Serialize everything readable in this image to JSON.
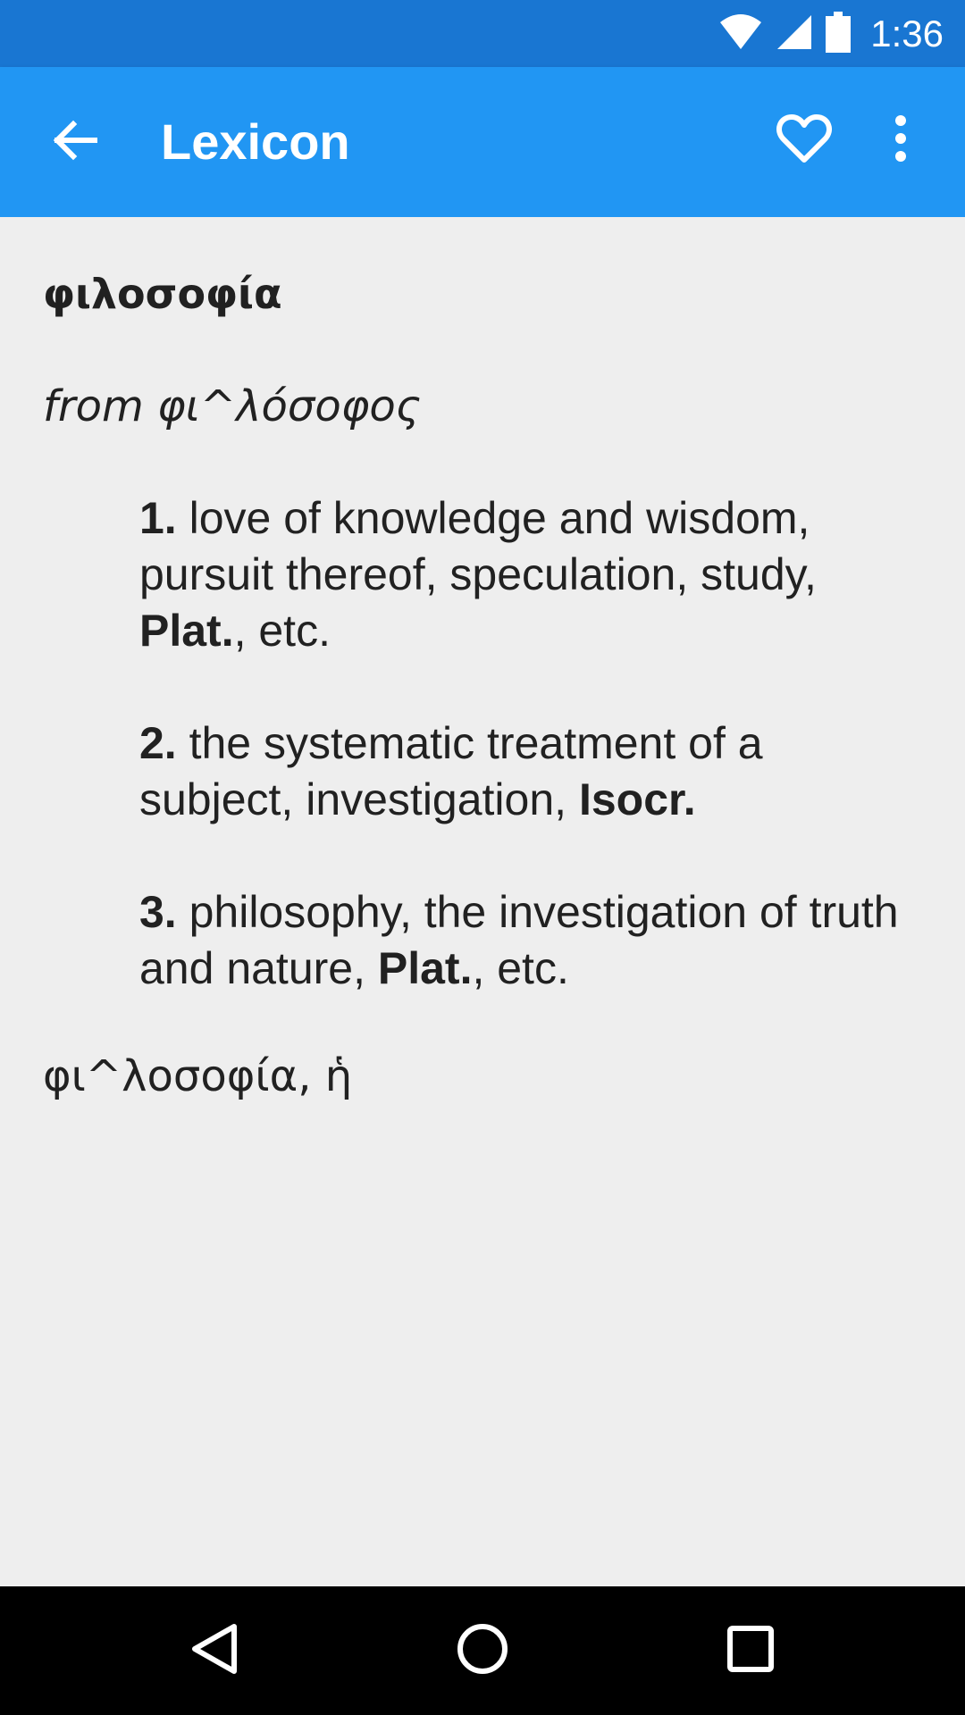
{
  "status_bar": {
    "time": "1:36",
    "icons": [
      "wifi-icon",
      "signal-icon",
      "battery-icon"
    ],
    "background": "#1976d2"
  },
  "app_bar": {
    "title": "Lexicon",
    "back_icon": "arrow-back-icon",
    "favorite_icon": "heart-outline-icon",
    "more_icon": "more-vert-icon",
    "background": "#2196f3"
  },
  "entry": {
    "headword": "φιλοσοφία",
    "etymology": "from φι^λόσοφος",
    "senses": [
      {
        "number": "1.",
        "text": " love of knowledge and wisdom, pursuit thereof, speculation, study, ",
        "ref": "Plat.",
        "tail": ", etc."
      },
      {
        "number": "2.",
        "text": " the systematic treatment of a subject, investigation, ",
        "ref": "Isocr.",
        "tail": ""
      },
      {
        "number": "3.",
        "text": " philosophy, the investigation of truth and nature, ",
        "ref": "Plat.",
        "tail": ", etc."
      }
    ],
    "lemma": "φι^λοσοφία, ἡ"
  },
  "nav_bar": {
    "icons": [
      "back-triangle-icon",
      "home-circle-icon",
      "recents-square-icon"
    ]
  }
}
